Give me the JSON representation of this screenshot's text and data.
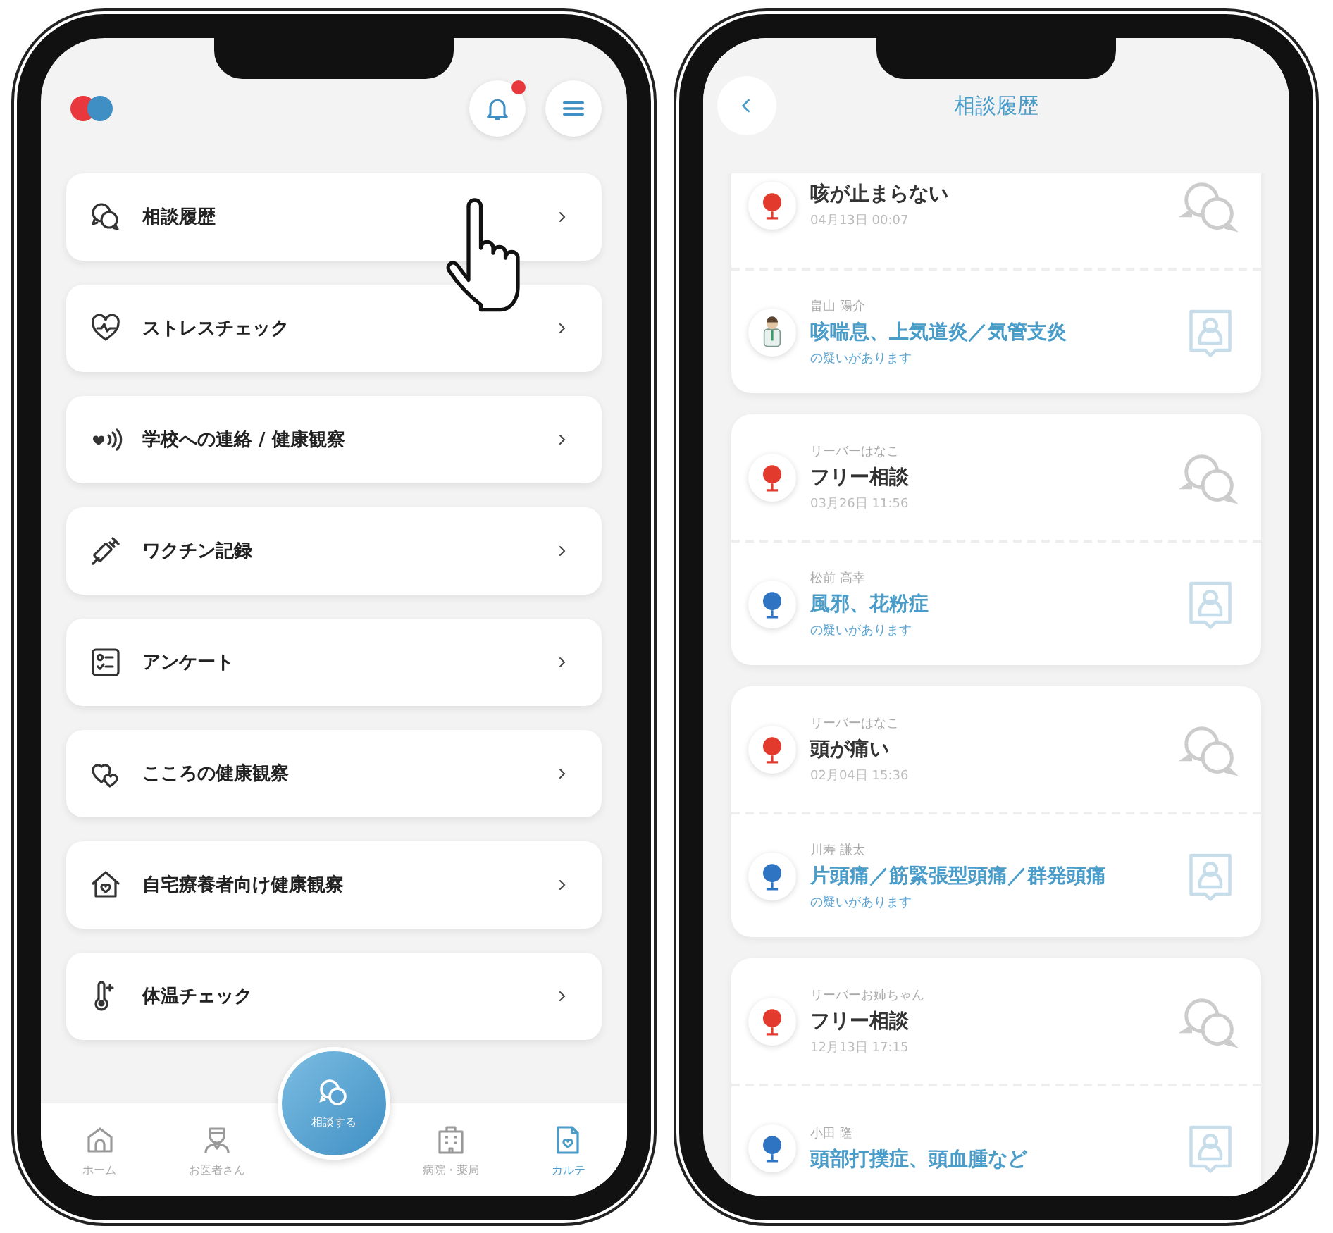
{
  "menu_screen": {
    "notifications": {
      "unread": true
    },
    "items": [
      {
        "label": "相談履歴"
      },
      {
        "label": "ストレスチェック"
      },
      {
        "label": "学校への連絡 / 健康観察"
      },
      {
        "label": "ワクチン記録"
      },
      {
        "label": "アンケート"
      },
      {
        "label": "こころの健康観察"
      },
      {
        "label": "自宅療養者向け健康観察"
      },
      {
        "label": "体温チェック"
      }
    ],
    "center_button": {
      "label": "相談する"
    },
    "bottom_nav": [
      {
        "label": "ホーム",
        "selected": false
      },
      {
        "label": "お医者さん",
        "selected": false
      },
      {
        "label": "病院・薬局",
        "selected": false
      },
      {
        "label": "カルテ",
        "selected": true
      }
    ]
  },
  "history_screen": {
    "title": "相談履歴",
    "cards": [
      {
        "consultation": {
          "title": "咳が止まらない",
          "date": "04月13日 00:07"
        },
        "diagnosis": {
          "doctor": "畠山 陽介",
          "kind": "person",
          "text": "咳喘息、上気道炎／気管支炎",
          "note": "の疑いがあります"
        }
      },
      {
        "consultation": {
          "name": "リーバーはなこ",
          "title": "フリー相談",
          "date": "03月26日 11:56"
        },
        "diagnosis": {
          "doctor": "松前 高幸",
          "kind": "mascot",
          "text": "風邪、花粉症",
          "note": "の疑いがあります"
        }
      },
      {
        "consultation": {
          "name": "リーバーはなこ",
          "title": "頭が痛い",
          "date": "02月04日 15:36"
        },
        "diagnosis": {
          "doctor": "川寿 謙太",
          "kind": "mascot",
          "text": "片頭痛／筋緊張型頭痛／群発頭痛",
          "note": "の疑いがあります"
        }
      },
      {
        "consultation": {
          "name": "リーバーお姉ちゃん",
          "title": "フリー相談",
          "date": "12月13日 17:15"
        },
        "diagnosis": {
          "doctor": "小田 隆",
          "kind": "mascot",
          "text": "頭部打撲症、頭血腫など"
        }
      }
    ]
  }
}
